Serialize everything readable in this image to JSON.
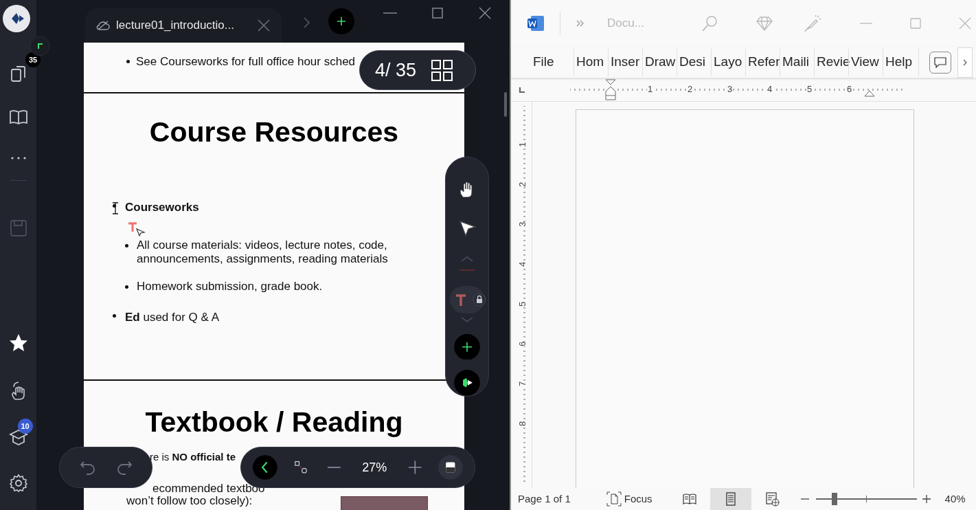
{
  "viewer": {
    "tab": {
      "title": "lecture01_introductio..."
    },
    "sidebar": [
      {
        "kind": "pages",
        "badge": "35",
        "disabled": false
      },
      {
        "kind": "book",
        "disabled": false
      },
      {
        "kind": "more",
        "disabled": false
      },
      {
        "kind": "save",
        "disabled": true
      },
      {
        "kind": "star",
        "disabled": false
      },
      {
        "kind": "gesture",
        "disabled": false
      },
      {
        "kind": "course",
        "badge": "10",
        "disabled": false
      },
      {
        "kind": "settings",
        "disabled": false
      }
    ],
    "page_counter": "4/ 35",
    "slides": [
      {
        "bullets": [
          "See Courseworks for full office hour sched"
        ]
      },
      {
        "title": "Course Resources",
        "items": [
          {
            "text": "**Courseworks**",
            "children": [
              {
                "text": "All course materials: videos, lecture notes, code, announcements, assignments, reading materials"
              },
              {
                "text": "Homework submission, grade book."
              }
            ]
          },
          {
            "text": "**Ed** used for Q & A"
          }
        ]
      },
      {
        "title": "Textbook / Reading",
        "lines": [
          "re is **NO official te**",
          "ecommended textboo",
          "won’t follow too closely):"
        ]
      }
    ],
    "tools": [
      {
        "kind": "hand",
        "selected": false
      },
      {
        "kind": "pointer",
        "selected": false
      },
      {
        "kind": "text",
        "selected": true,
        "locked": true
      }
    ],
    "zoom": "27%"
  },
  "word": {
    "title": "Docu...",
    "ribbon_tabs": [
      "File",
      "Hom",
      "Inser",
      "Draw",
      "Desi",
      "Layo",
      "Refer",
      "Maili",
      "Revie",
      "View",
      "Help"
    ],
    "ruler": [
      "1",
      "2",
      "3",
      "4",
      "5",
      "6"
    ],
    "vertical_ruler": [
      "1",
      "2",
      "3",
      "4",
      "5",
      "6",
      "7",
      "8"
    ],
    "status_bar": {
      "page": "Page 1 of 1",
      "focus": "Focus",
      "views": [
        {
          "kind": "read",
          "selected": false
        },
        {
          "kind": "print",
          "selected": true
        },
        {
          "kind": "web",
          "selected": false
        }
      ],
      "level": 0.17,
      "zoom": "40%"
    }
  }
}
